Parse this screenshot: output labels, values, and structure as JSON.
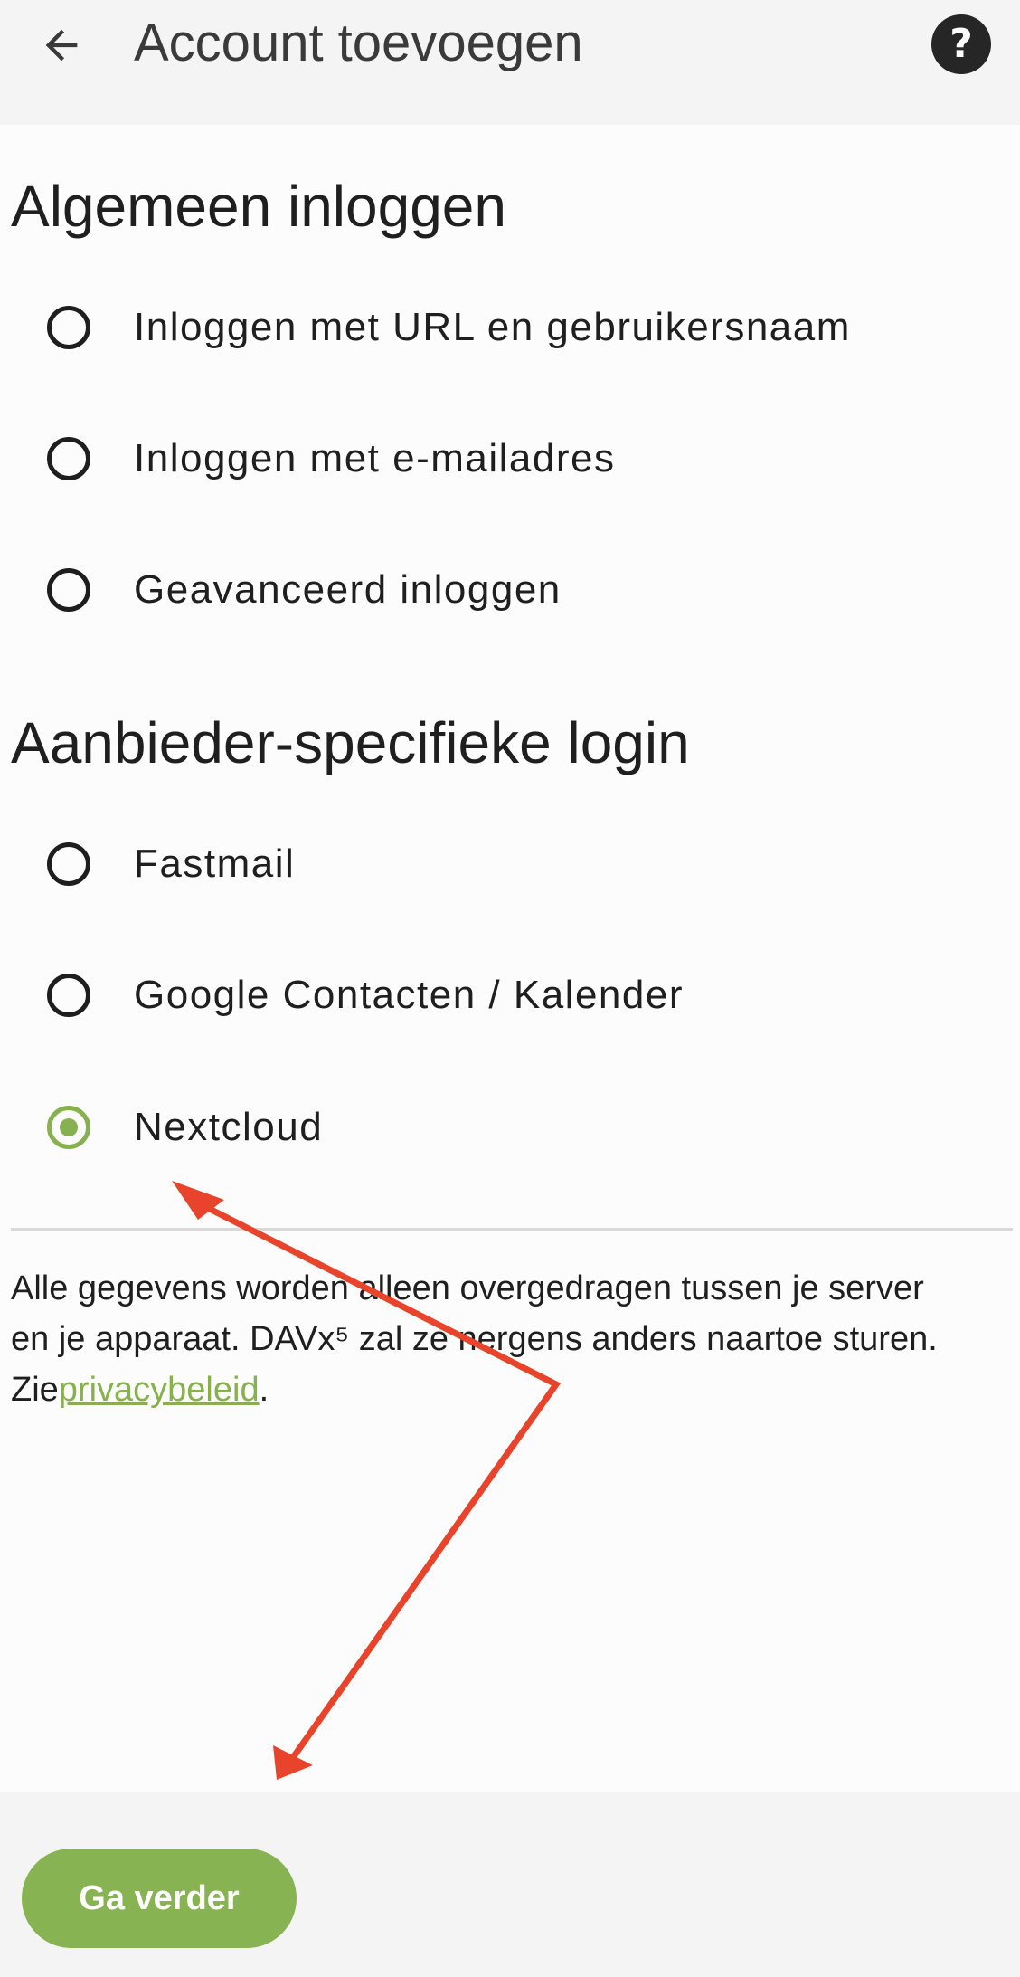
{
  "app_bar": {
    "back_icon": "arrow-back-icon",
    "title": "Account toevoegen",
    "help_icon": "help-circle-icon",
    "help_glyph": "?"
  },
  "general_login": {
    "title": "Algemeen inloggen",
    "options": [
      {
        "label": "Inloggen met URL en gebruikersnaam",
        "selected": false
      },
      {
        "label": "Inloggen met e-mailadres",
        "selected": false
      },
      {
        "label": "Geavanceerd inloggen",
        "selected": false
      }
    ]
  },
  "provider_login": {
    "title": "Aanbieder-specifieke login",
    "options": [
      {
        "label": "Fastmail",
        "selected": false
      },
      {
        "label": "Google Contacten / Kalender",
        "selected": false
      },
      {
        "label": "Nextcloud",
        "selected": true
      }
    ]
  },
  "info": {
    "line1": "Alle gegevens worden alleen overgedragen tussen je server",
    "line2": "en je apparaat. DAVx⁵ zal ze nergens anders naartoe sturen.",
    "line3_prefix": "Zie",
    "privacy_link": "privacybeleid",
    "line3_suffix": "."
  },
  "footer": {
    "continue_label": "Ga verder"
  },
  "colors": {
    "accent": "#86b14e",
    "annotation_arrow": "#e8442c",
    "app_bar_bg": "#f4f4f4",
    "page_bg": "#fcfcfc"
  }
}
